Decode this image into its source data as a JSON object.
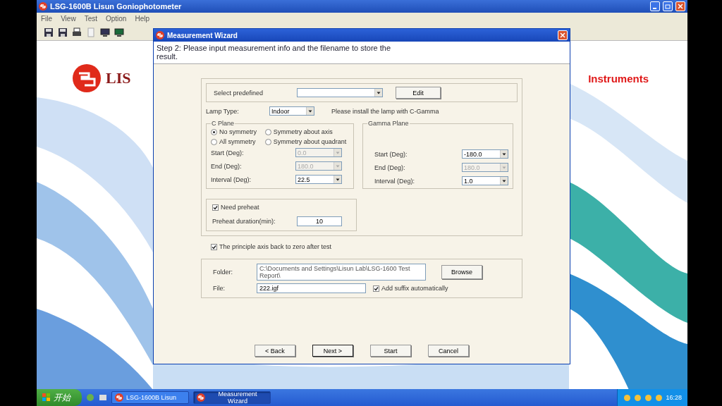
{
  "main_window": {
    "title": "LSG-1600B Lisun Goniophotometer",
    "menu": [
      "File",
      "View",
      "Test",
      "Option",
      "Help"
    ],
    "logo_text": "LIS",
    "brand_text": "Instruments"
  },
  "dialog": {
    "title": "Measurement Wizard",
    "step_text": "Step 2: Please input measurement info and the filename to store the result.",
    "predefined": {
      "label": "Select predefined",
      "button": "Edit"
    },
    "lamp_type": {
      "label": "Lamp Type:",
      "value": "Indoor"
    },
    "note": "Please install the lamp with C-Gamma",
    "c_plane": {
      "title": "C Plane",
      "options": [
        {
          "label": "No symmetry",
          "selected": true
        },
        {
          "label": "Symmetry about axis",
          "selected": false
        },
        {
          "label": "All symmetry",
          "selected": false
        },
        {
          "label": "Symmetry about quadrant",
          "selected": false
        }
      ],
      "fields": [
        {
          "label": "Start (Deg):",
          "value": "0.0",
          "disabled": true
        },
        {
          "label": "End (Deg):",
          "value": "180.0",
          "disabled": true
        },
        {
          "label": "Interval (Deg):",
          "value": "22.5",
          "disabled": false
        }
      ]
    },
    "gamma_plane": {
      "title": "Gamma Plane",
      "fields": [
        {
          "label": "Start (Deg):",
          "value": "-180.0",
          "disabled": false
        },
        {
          "label": "End (Deg):",
          "value": "180.0",
          "disabled": true
        },
        {
          "label": "Interval (Deg):",
          "value": "1.0",
          "disabled": false
        }
      ]
    },
    "preheat": {
      "label": "Need preheat",
      "checked": true,
      "duration_label": "Preheat duration(min):",
      "duration": "10"
    },
    "zero_axis": {
      "label": "The principle axis back to zero after test",
      "checked": true
    },
    "folder": {
      "label": "Folder:",
      "value": "C:\\Documents and Settings\\Lisun Lab\\LSG-1600 Test Report\\",
      "button": "Browse"
    },
    "file": {
      "label": "File:",
      "value": "222.igf"
    },
    "add_suffix": {
      "label": "Add suffix automatically",
      "checked": true
    },
    "buttons": [
      {
        "label": "< Back",
        "default": false
      },
      {
        "label": "Next >",
        "default": true
      },
      {
        "label": "Start",
        "default": false
      },
      {
        "label": "Cancel",
        "default": false
      }
    ]
  },
  "taskbar": {
    "start": "开始",
    "items": [
      {
        "label": "LSG-1600B Lisun",
        "selected": false
      },
      {
        "label": "Measurement Wizard",
        "selected": true
      }
    ],
    "clock": "16:28"
  }
}
